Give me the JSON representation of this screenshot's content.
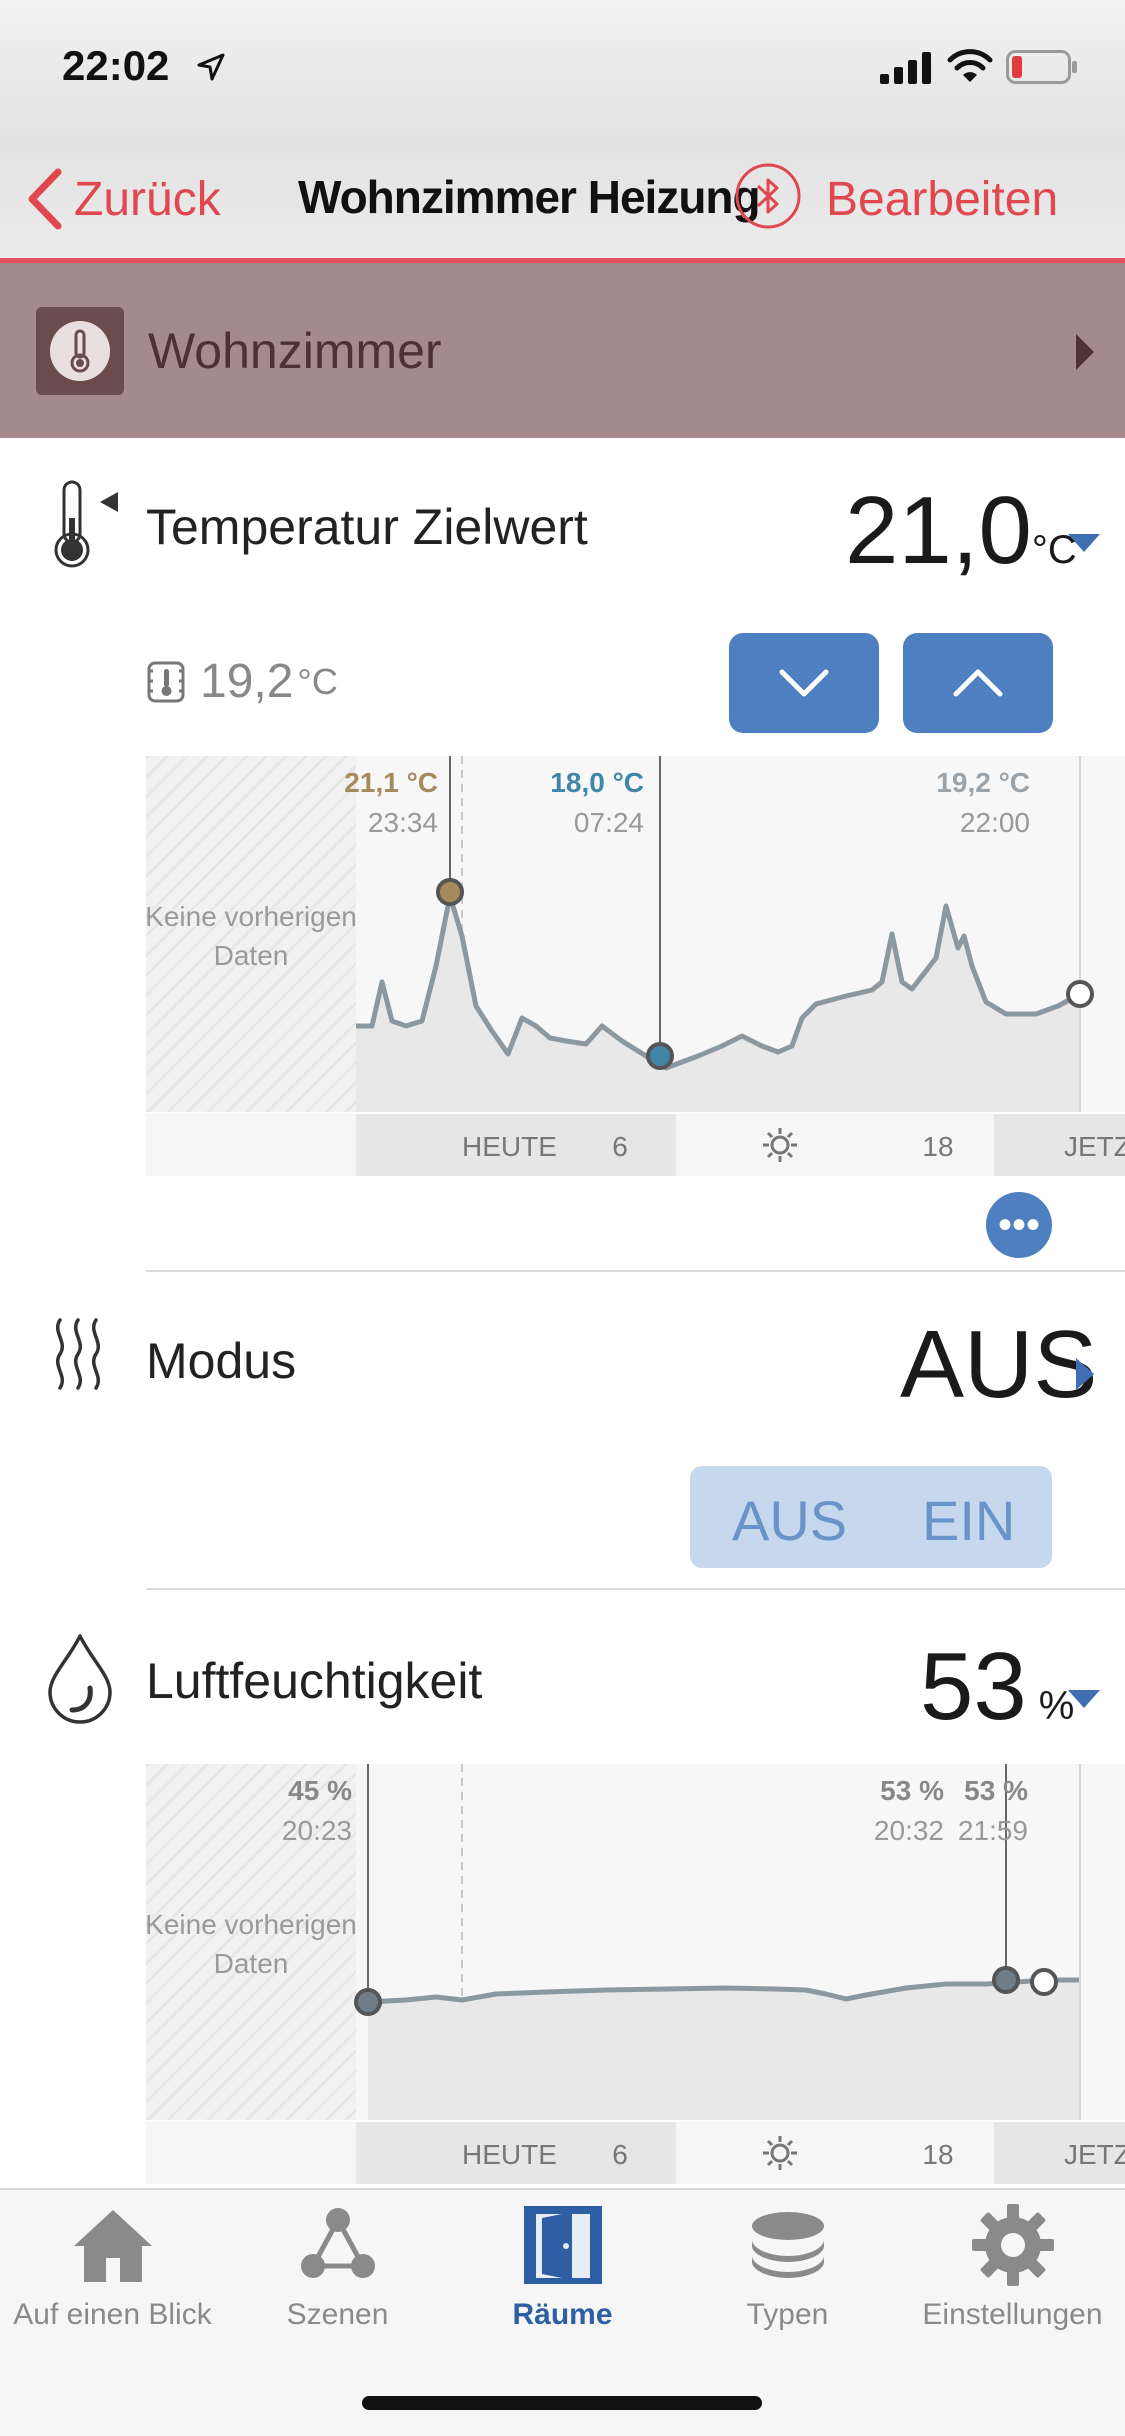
{
  "status": {
    "time": "22:02"
  },
  "nav": {
    "back_label": "Zurück",
    "title": "Wohnzimmer Heizung",
    "edit_label": "Bearbeiten"
  },
  "room": {
    "name": "Wohnzimmer"
  },
  "temperature": {
    "label": "Temperatur Zielwert",
    "target_value": "21,0",
    "unit": "°C",
    "current_value": "19,2",
    "current_unit": "°C",
    "chart": {
      "no_data_line1": "Keine vorherigen",
      "no_data_line2": "Daten",
      "markers": [
        {
          "value": "21,1 °C",
          "time": "23:34",
          "color": "#a58a5a"
        },
        {
          "value": "18,0 °C",
          "time": "07:24",
          "color": "#3f86a8"
        },
        {
          "value": "19,2 °C",
          "time": "22:00",
          "color": "#9aa3aa"
        }
      ],
      "axis": {
        "today": "HEUTE",
        "tick6": "6",
        "tick18": "18",
        "now": "JETZT"
      }
    }
  },
  "mode": {
    "label": "Modus",
    "value": "AUS",
    "options": [
      "AUS",
      "EIN"
    ]
  },
  "humidity": {
    "label": "Luftfeuchtigkeit",
    "value": "53",
    "unit": "%",
    "chart": {
      "no_data_line1": "Keine vorherigen",
      "no_data_line2": "Daten",
      "markers": [
        {
          "value": "45 %",
          "time": "20:23"
        },
        {
          "value": "53 %",
          "time": "20:32"
        },
        {
          "value": "53 %",
          "time": "21:59"
        }
      ],
      "axis": {
        "today": "HEUTE",
        "tick6": "6",
        "tick18": "18",
        "now": "JETZT"
      }
    }
  },
  "tabs": [
    {
      "label": "Auf einen Blick",
      "icon": "house-icon"
    },
    {
      "label": "Szenen",
      "icon": "scenes-icon"
    },
    {
      "label": "Räume",
      "icon": "door-icon",
      "active": true
    },
    {
      "label": "Typen",
      "icon": "layers-icon"
    },
    {
      "label": "Einstellungen",
      "icon": "gear-icon"
    }
  ],
  "colors": {
    "accent_red": "#e1474e",
    "accent_blue": "#4e7fc0",
    "room_bar": "#a58a8d"
  }
}
